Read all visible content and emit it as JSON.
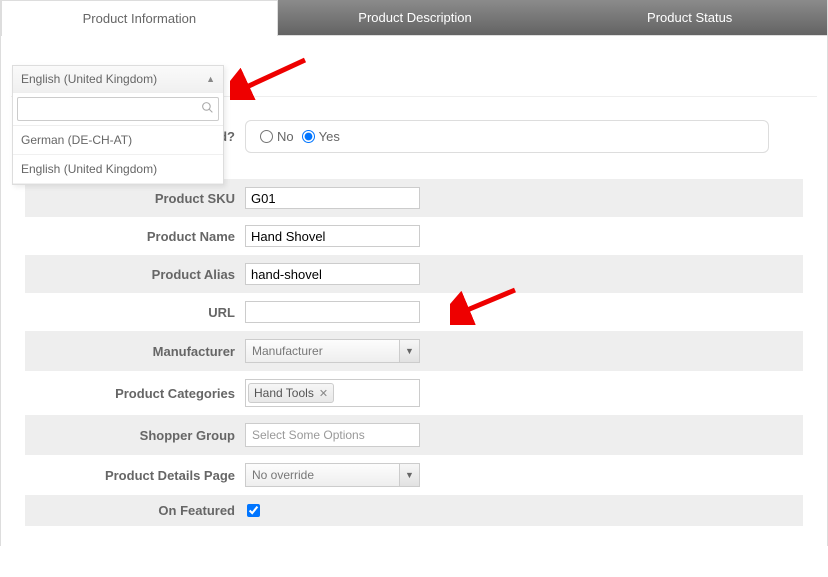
{
  "tabs": {
    "info": "Product Information",
    "desc": "Product Description",
    "status": "Product Status"
  },
  "language": {
    "selected": "English (United Kingdom)",
    "options": {
      "german": "German (DE-CH-AT)",
      "english_uk": "English (United Kingdom)"
    }
  },
  "labels": {
    "published": "Published?",
    "sku": "Product SKU",
    "name": "Product Name",
    "alias": "Product Alias",
    "url": "URL",
    "manufacturer": "Manufacturer",
    "categories": "Product Categories",
    "shopper_group": "Shopper Group",
    "details_page": "Product Details Page",
    "featured": "On Featured"
  },
  "values": {
    "published_no": "No",
    "published_yes": "Yes",
    "sku": "G01",
    "name": "Hand Shovel",
    "alias": "hand-shovel",
    "url": "",
    "manufacturer": "Manufacturer",
    "category_tag": "Hand Tools",
    "shopper_group_placeholder": "Select Some Options",
    "details_page": "No override"
  }
}
